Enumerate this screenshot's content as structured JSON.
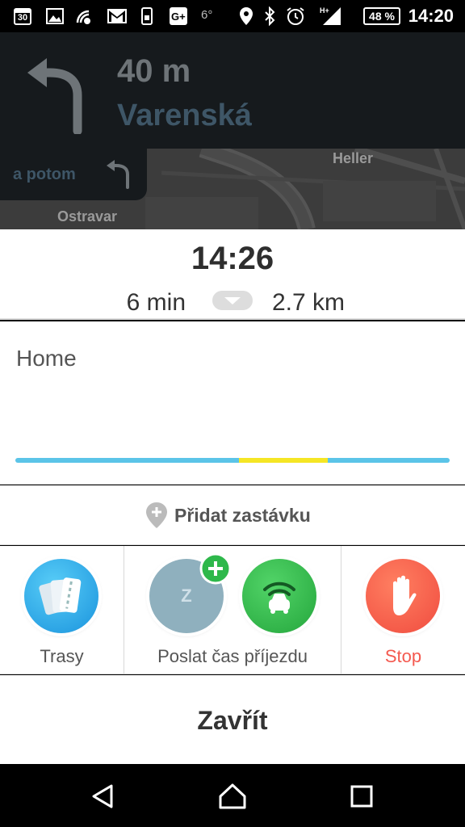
{
  "status_bar": {
    "date_icon": "30",
    "temperature": "6°",
    "battery": "48 %",
    "time": "14:20",
    "icons": [
      "calendar-icon",
      "gallery-icon",
      "wifi-broadcast-icon",
      "gmail-icon",
      "phone-icon",
      "google-plus-icon",
      "location-icon",
      "bluetooth-icon",
      "alarm-icon",
      "signal-icon",
      "battery-icon"
    ]
  },
  "nav": {
    "distance": "40 m",
    "street": "Varenská",
    "then_label": "a potom",
    "turn_icon": "turn-left-icon"
  },
  "map": {
    "labels": [
      "Heller",
      "Ostravar"
    ]
  },
  "eta": {
    "arrival_time": "14:26",
    "duration": "6 min",
    "distance": "2.7 km"
  },
  "destination": {
    "name": "Home",
    "route_segments": [
      {
        "fraction": 0.515,
        "color": "#5bc4e8"
      },
      {
        "fraction": 0.205,
        "color": "#f5e625"
      },
      {
        "fraction": 0.28,
        "color": "#5bc4e8"
      }
    ]
  },
  "add_stop": {
    "label": "Přidat zastávku"
  },
  "actions": {
    "routes_label": "Trasy",
    "send_eta_label": "Poslat čas příjezdu",
    "contact_initial": "Z",
    "stop_label": "Stop"
  },
  "close": {
    "label": "Zavřít"
  },
  "colors": {
    "accent_blue": "#3e5667",
    "stop_red": "#f4594f",
    "waze_green": "#2eb84b",
    "routes_blue": "#2aa9e6"
  }
}
